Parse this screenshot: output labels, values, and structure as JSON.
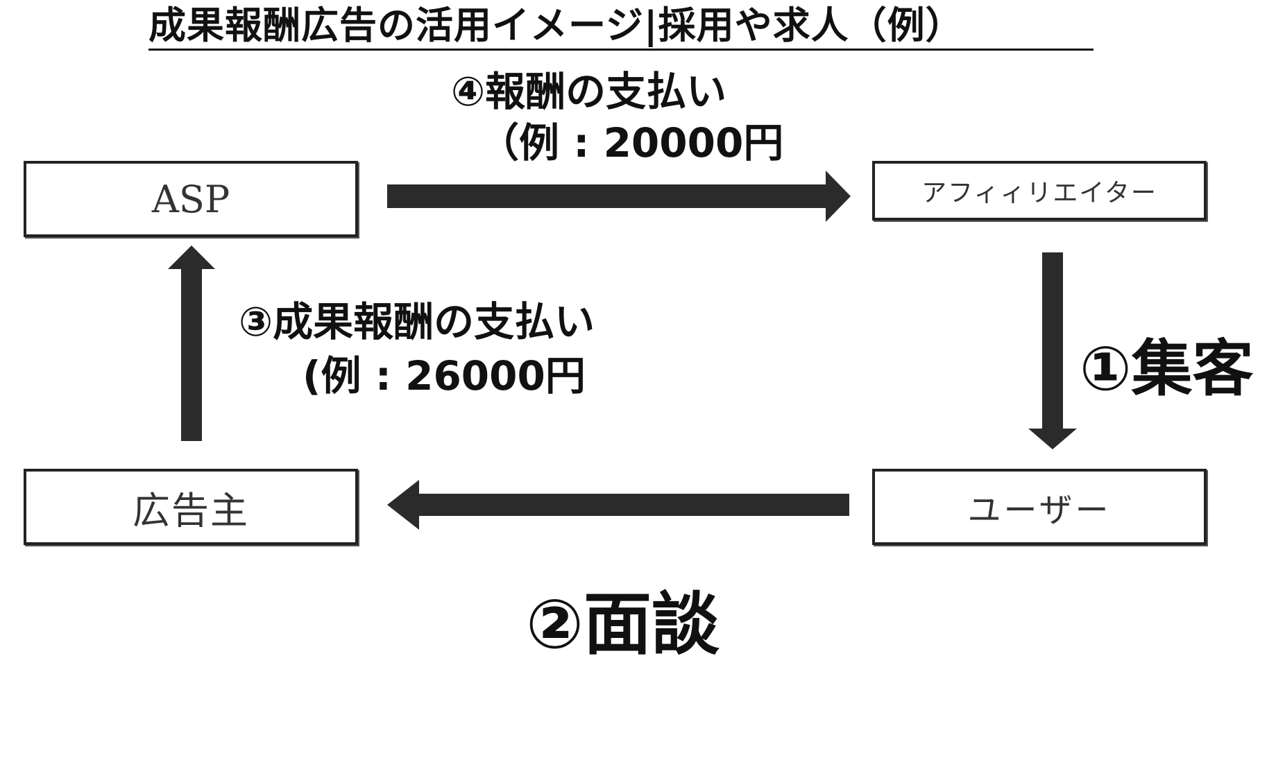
{
  "title": "成果報酬広告の活用イメージ|採用や求人（例）",
  "nodes": {
    "asp": "ASP",
    "affiliate": "アフィィリエイター",
    "advertiser": "広告主",
    "user": "ユーザー"
  },
  "steps": {
    "step1": "①集客",
    "step2": "②面談",
    "step3": {
      "line1": "③成果報酬の支払い",
      "line2": "(例 : 26000円"
    },
    "step4": {
      "line1": "④報酬の支払い",
      "line2": "（例 : 20000円"
    }
  },
  "colors": {
    "arrow": "#2b2b2b",
    "border": "#222222",
    "text": "#111111"
  }
}
